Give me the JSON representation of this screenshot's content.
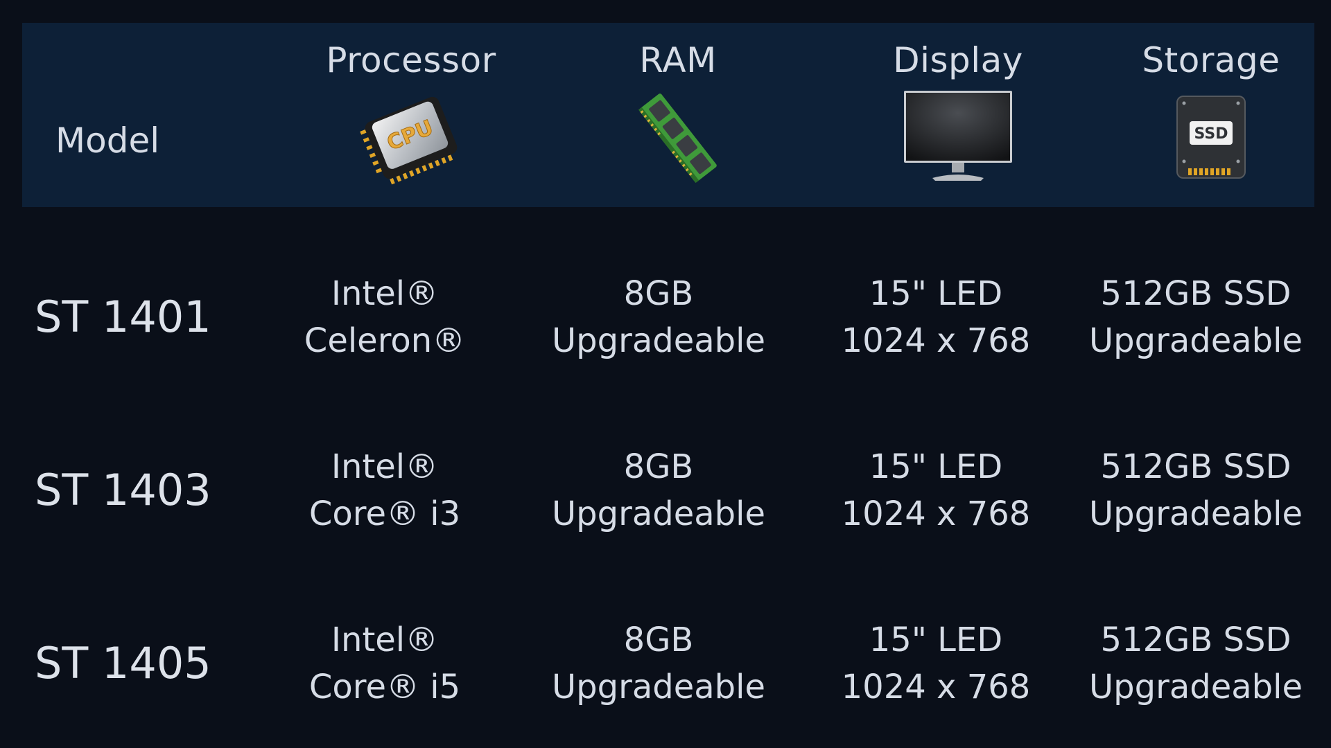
{
  "header": {
    "model_label": "Model",
    "columns": [
      {
        "label": "Processor",
        "icon": "cpu-chip-icon"
      },
      {
        "label": "RAM",
        "icon": "ram-module-icon"
      },
      {
        "label": "Display",
        "icon": "monitor-icon"
      },
      {
        "label": "Storage",
        "icon": "ssd-drive-icon"
      }
    ],
    "ssd_icon_text": "SSD",
    "cpu_icon_text": "CPU"
  },
  "rows": [
    {
      "model": "ST 1401",
      "processor": [
        "Intel®",
        "Celeron®"
      ],
      "ram": [
        "8GB",
        "Upgradeable"
      ],
      "display": [
        "15\" LED",
        "1024 x 768"
      ],
      "storage": [
        "512GB SSD",
        "Upgradeable"
      ]
    },
    {
      "model": "ST 1403",
      "processor": [
        "Intel®",
        "Core® i3"
      ],
      "ram": [
        "8GB",
        "Upgradeable"
      ],
      "display": [
        "15\" LED",
        "1024 x 768"
      ],
      "storage": [
        "512GB SSD",
        "Upgradeable"
      ]
    },
    {
      "model": "ST 1405",
      "processor": [
        "Intel®",
        "Core® i5"
      ],
      "ram": [
        "8GB",
        "Upgradeable"
      ],
      "display": [
        "15\" LED",
        "1024 x 768"
      ],
      "storage": [
        "512GB SSD",
        "Upgradeable"
      ]
    }
  ],
  "colors": {
    "background": "#0a0f19",
    "header_band": "#0d2037",
    "text": "#d6dce6"
  }
}
